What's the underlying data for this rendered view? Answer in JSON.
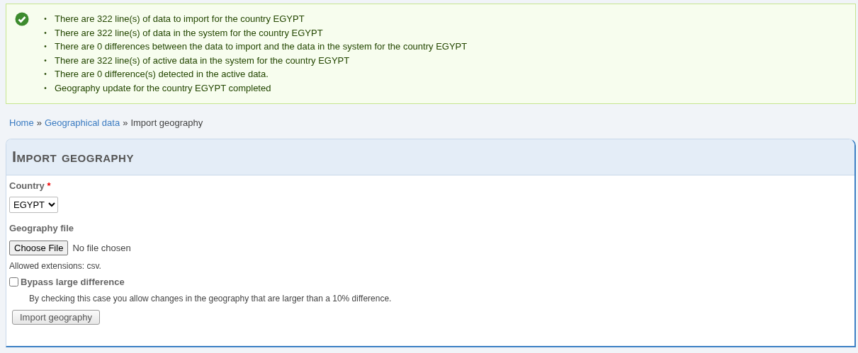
{
  "status_message": {
    "kind": "success",
    "items": [
      {
        "marker": "•",
        "text": "There are 322 line(s) of data to import for the country EGYPT"
      },
      {
        "marker": "•",
        "text": "There are 322 line(s) of data in the system for the country EGYPT"
      },
      {
        "marker": "•",
        "text": "There are 0 differences between the data to import and the data in the system for the country EGYPT"
      },
      {
        "marker": "•",
        "text": "There are 322 line(s) of active data in the system for the country EGYPT"
      },
      {
        "marker": "•",
        "text": "There are 0 difference(s) detected in the active data."
      },
      {
        "marker": "•",
        "text": "Geography update for the country EGYPT completed"
      }
    ]
  },
  "breadcrumb": [
    {
      "label": "Home",
      "link": true
    },
    {
      "label": "»",
      "link": false
    },
    {
      "label": "Geographical data",
      "link": true
    },
    {
      "label": "»",
      "link": false
    },
    {
      "label": "Import geography",
      "link": false
    }
  ],
  "panel": {
    "title": "Import geography",
    "country": {
      "label": "Country",
      "required_mark": "*",
      "value": "EGYPT"
    },
    "file": {
      "label": "Geography file",
      "button": "Choose File",
      "status": "No file chosen",
      "help": "Allowed extensions: csv."
    },
    "bypass": {
      "label": "Bypass large difference",
      "checked": false,
      "description": "By checking this case you allow changes in the geography that are larger than a 10% difference."
    },
    "submit": "Import geography"
  }
}
